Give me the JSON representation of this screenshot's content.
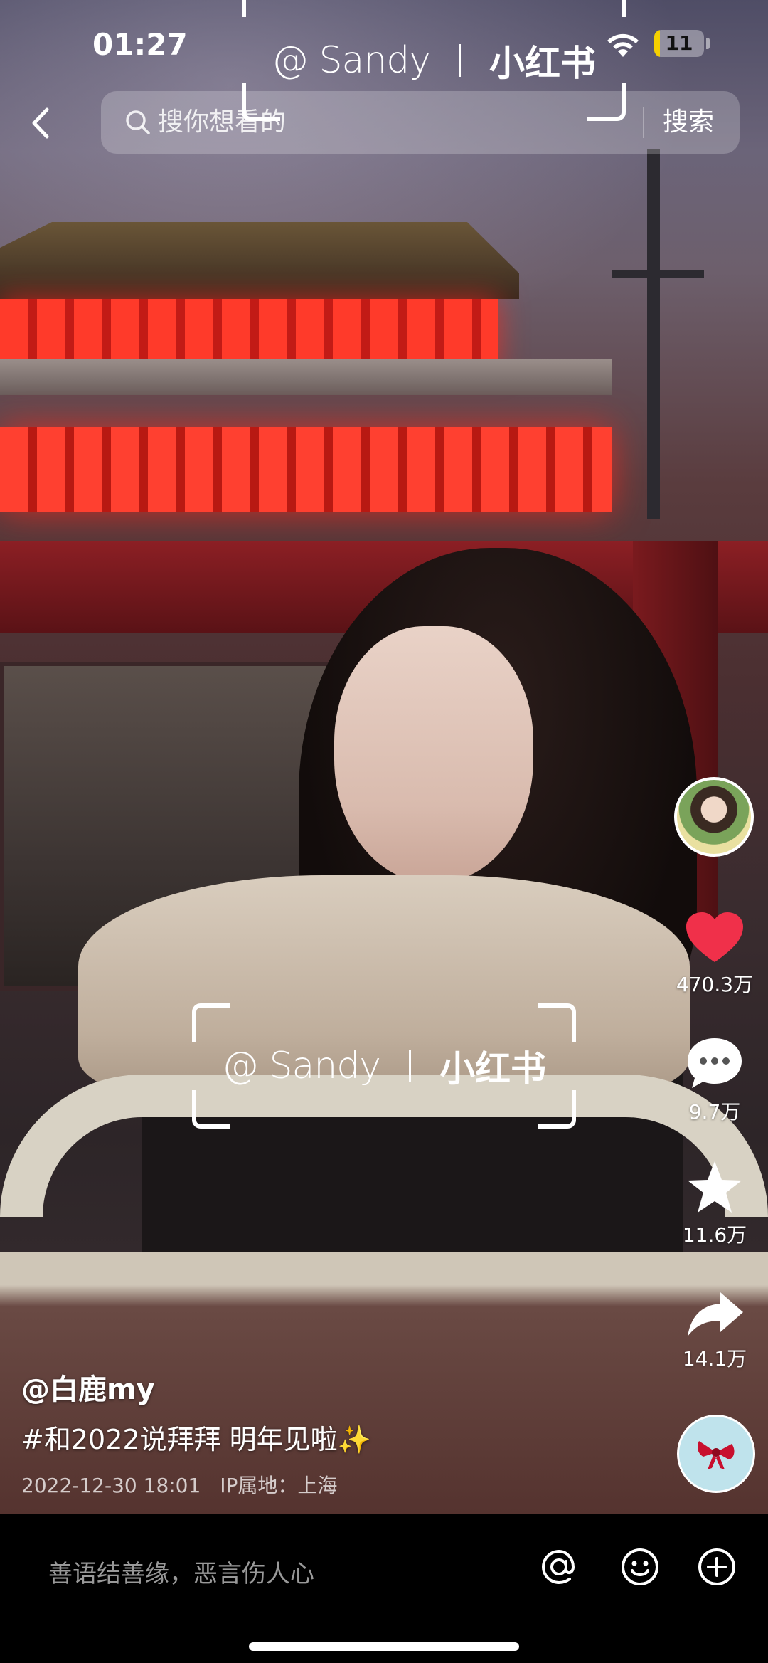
{
  "status_bar": {
    "time": "01:27",
    "battery_level": "11",
    "battery_fraction": 0.11
  },
  "header": {
    "search_placeholder": "搜你想看的",
    "search_button": "搜索"
  },
  "watermark": {
    "user": "@ Sandy",
    "brand": "小红书"
  },
  "actions": {
    "likes": "470.3万",
    "comments": "9.7万",
    "collects": "11.6万",
    "shares": "14.1万"
  },
  "post": {
    "author": "@白鹿my",
    "caption": "#和2022说拜拜 明年见啦✨",
    "timestamp": "2022-12-30 18:01",
    "location": "IP属地：上海"
  },
  "bottom_bar": {
    "comment_placeholder": "善语结善缘，恶言伤人心"
  },
  "colors": {
    "like_red": "#f0304a",
    "battery_yellow": "#f5d000"
  },
  "icons": [
    "back-icon",
    "search-icon",
    "wifi-icon",
    "heart-icon",
    "comment-icon",
    "star-icon",
    "share-icon",
    "at-icon",
    "emoji-icon",
    "plus-icon"
  ]
}
